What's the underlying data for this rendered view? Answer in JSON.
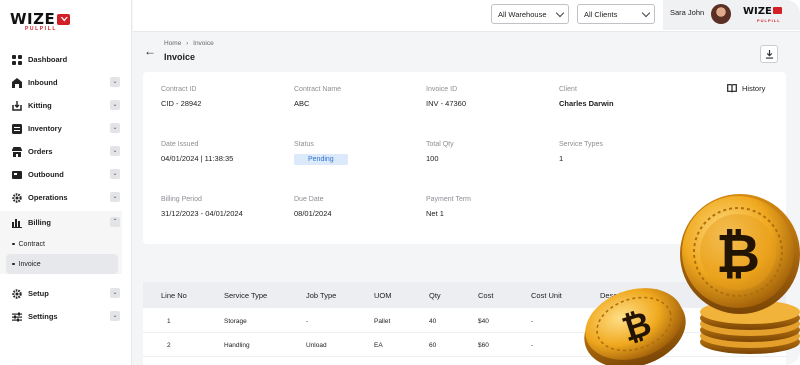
{
  "brand": {
    "name": "WIZE",
    "tagline": "PULPILL"
  },
  "topbar": {
    "warehouse_select": "All Warehouse",
    "clients_select": "All Clients",
    "user_name": "Sara John"
  },
  "sidebar": {
    "items": [
      {
        "label": "Dashboard",
        "icon": "grid-icon"
      },
      {
        "label": "Inbound",
        "icon": "warehouse-icon"
      },
      {
        "label": "Kitting",
        "icon": "box-download-icon"
      },
      {
        "label": "Inventory",
        "icon": "list-box-icon"
      },
      {
        "label": "Orders",
        "icon": "shop-icon"
      },
      {
        "label": "Outbound",
        "icon": "truck-box-icon"
      },
      {
        "label": "Operations",
        "icon": "gear-icon"
      },
      {
        "label": "Billing",
        "icon": "bar-chart-icon"
      }
    ],
    "billing_sub": [
      "Contract",
      "Invoice"
    ],
    "bottom_items": [
      {
        "label": "Setup",
        "icon": "gear-icon"
      },
      {
        "label": "Settings",
        "icon": "sliders-icon"
      }
    ]
  },
  "page": {
    "breadcrumb_home": "Home",
    "breadcrumb_sep": "›",
    "breadcrumb_current": "Invoice",
    "title": "Invoice"
  },
  "details": {
    "history_label": "History",
    "contract_id": {
      "label": "Contract ID",
      "value": "CID - 28942"
    },
    "contract_name": {
      "label": "Contract Name",
      "value": "ABC"
    },
    "invoice_id": {
      "label": "Invoice ID",
      "value": "INV - 47360"
    },
    "client": {
      "label": "Client",
      "value": "Charles Darwin"
    },
    "date_issued": {
      "label": "Date Issued",
      "value": "04/01/2024 | 11:38:35"
    },
    "status": {
      "label": "Status",
      "value": "Pending"
    },
    "total_qty": {
      "label": "Total Qty",
      "value": "100"
    },
    "service_types": {
      "label": "Service Types",
      "value": "1"
    },
    "billing_period": {
      "label": "Billing Period",
      "value": "31/12/2023 - 04/01/2024"
    },
    "due_date": {
      "label": "Due Date",
      "value": "08/01/2024"
    },
    "payment_term": {
      "label": "Payment Term",
      "value": "Net 1"
    }
  },
  "table": {
    "columns": [
      "Line No",
      "Service Type",
      "Job Type",
      "UOM",
      "Qty",
      "Cost",
      "Cost Unit",
      "Description"
    ],
    "rows": [
      [
        "1",
        "Storage",
        "-",
        "Pallet",
        "40",
        "$40",
        "-",
        ""
      ],
      [
        "2",
        "Handling",
        "Unload",
        "EA",
        "60",
        "$60",
        "-",
        ""
      ]
    ]
  },
  "colors": {
    "brand_red": "#d32027",
    "status_bg": "#dbe9fb",
    "status_text": "#2f74d0",
    "coin_gold": "#e8a51f"
  }
}
